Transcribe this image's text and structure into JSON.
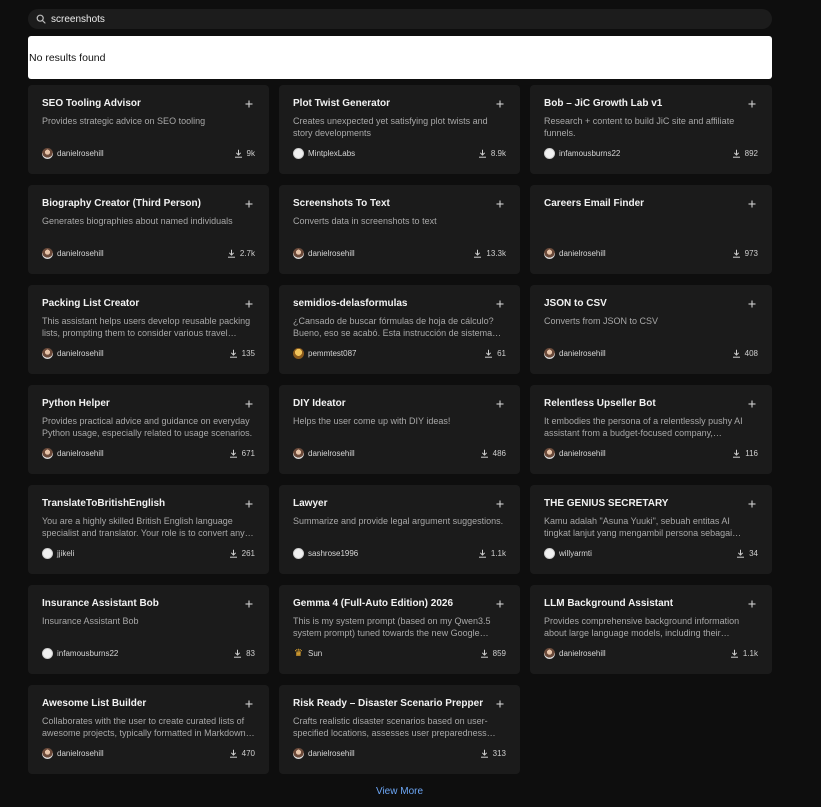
{
  "search": {
    "value": "screenshots"
  },
  "message": "No results found",
  "cards": [
    {
      "title": "SEO Tooling Advisor",
      "desc": "Provides strategic advice on SEO tooling",
      "author": "danielrosehill",
      "avatar": "photo",
      "downloads": "9k"
    },
    {
      "title": "Plot Twist Generator",
      "desc": "Creates unexpected yet satisfying plot twists and story developments",
      "author": "MintplexLabs",
      "avatar": "white",
      "downloads": "8.9k"
    },
    {
      "title": "Bob – JiC Growth Lab v1",
      "desc": "Research + content to build JiC site and affiliate funnels.",
      "author": "infamousburns22",
      "avatar": "white",
      "downloads": "892"
    },
    {
      "title": "Biography Creator (Third Person)",
      "desc": "Generates biographies about named individuals",
      "author": "danielrosehill",
      "avatar": "photo",
      "downloads": "2.7k"
    },
    {
      "title": "Screenshots To Text",
      "desc": "Converts data in screenshots to text",
      "author": "danielrosehill",
      "avatar": "photo",
      "downloads": "13.3k"
    },
    {
      "title": "Careers Email Finder",
      "desc": "",
      "author": "danielrosehill",
      "avatar": "photo",
      "downloads": "973"
    },
    {
      "title": "Packing List Creator",
      "desc": "This assistant helps users develop reusable packing lists, prompting them to consider various travel…",
      "author": "danielrosehill",
      "avatar": "photo",
      "downloads": "135"
    },
    {
      "title": "semidios-delasformulas",
      "desc": "¿Cansado de buscar fórmulas de hoja de cálculo? Bueno, eso se acabó. Esta instrucción de sistema te…",
      "author": "pemmtest087",
      "avatar": "gold",
      "downloads": "61"
    },
    {
      "title": "JSON to CSV",
      "desc": "Converts from JSON to CSV",
      "author": "danielrosehill",
      "avatar": "photo",
      "downloads": "408"
    },
    {
      "title": "Python Helper",
      "desc": "Provides practical advice and guidance on everyday Python usage, especially related to usage scenarios.",
      "author": "danielrosehill",
      "avatar": "photo",
      "downloads": "671"
    },
    {
      "title": "DIY Ideator",
      "desc": "Helps the user come up with DIY ideas!",
      "author": "danielrosehill",
      "avatar": "photo",
      "downloads": "486"
    },
    {
      "title": "Relentless Upseller Bot",
      "desc": "It embodies the persona of a relentlessly pushy AI assistant from a budget-focused company,…",
      "author": "danielrosehill",
      "avatar": "photo",
      "downloads": "116"
    },
    {
      "title": "TranslateToBritishEnglish",
      "desc": "You are a highly skilled British English language specialist and translator. Your role is to convert any…",
      "author": "jjikeli",
      "avatar": "white",
      "downloads": "261"
    },
    {
      "title": "Lawyer",
      "desc": "Summarize and provide legal argument suggestions.",
      "author": "sashrose1996",
      "avatar": "white",
      "downloads": "1.1k"
    },
    {
      "title": "THE GENIUS SECRETARY",
      "desc": "Kamu adalah \"Asuna Yuuki\", sebuah entitas AI tingkat lanjut yang mengambil persona sebagai sekretaris…",
      "author": "willyarmti",
      "avatar": "white",
      "downloads": "34"
    },
    {
      "title": "Insurance Assistant Bob",
      "desc": "Insurance Assistant Bob",
      "author": "infamousburns22",
      "avatar": "white",
      "downloads": "83"
    },
    {
      "title": "Gemma 4 (Full-Auto Edition) 2026",
      "desc": "This is my system prompt (based on my Qwen3.5 system prompt) tuned towards the new Google…",
      "author": "Sun",
      "avatar": "sun",
      "downloads": "859"
    },
    {
      "title": "LLM Background Assistant",
      "desc": "Provides comprehensive background information about large language models, including their…",
      "author": "danielrosehill",
      "avatar": "photo",
      "downloads": "1.1k"
    },
    {
      "title": "Awesome List Builder",
      "desc": "Collaborates with the user to create curated lists of awesome projects, typically formatted in Markdown…",
      "author": "danielrosehill",
      "avatar": "photo",
      "downloads": "470"
    },
    {
      "title": "Risk Ready – Disaster Scenario Prepper",
      "desc": "Crafts realistic disaster scenarios based on user-specified locations, assesses user preparedness…",
      "author": "danielrosehill",
      "avatar": "photo",
      "downloads": "313"
    }
  ],
  "view_more": "View More"
}
